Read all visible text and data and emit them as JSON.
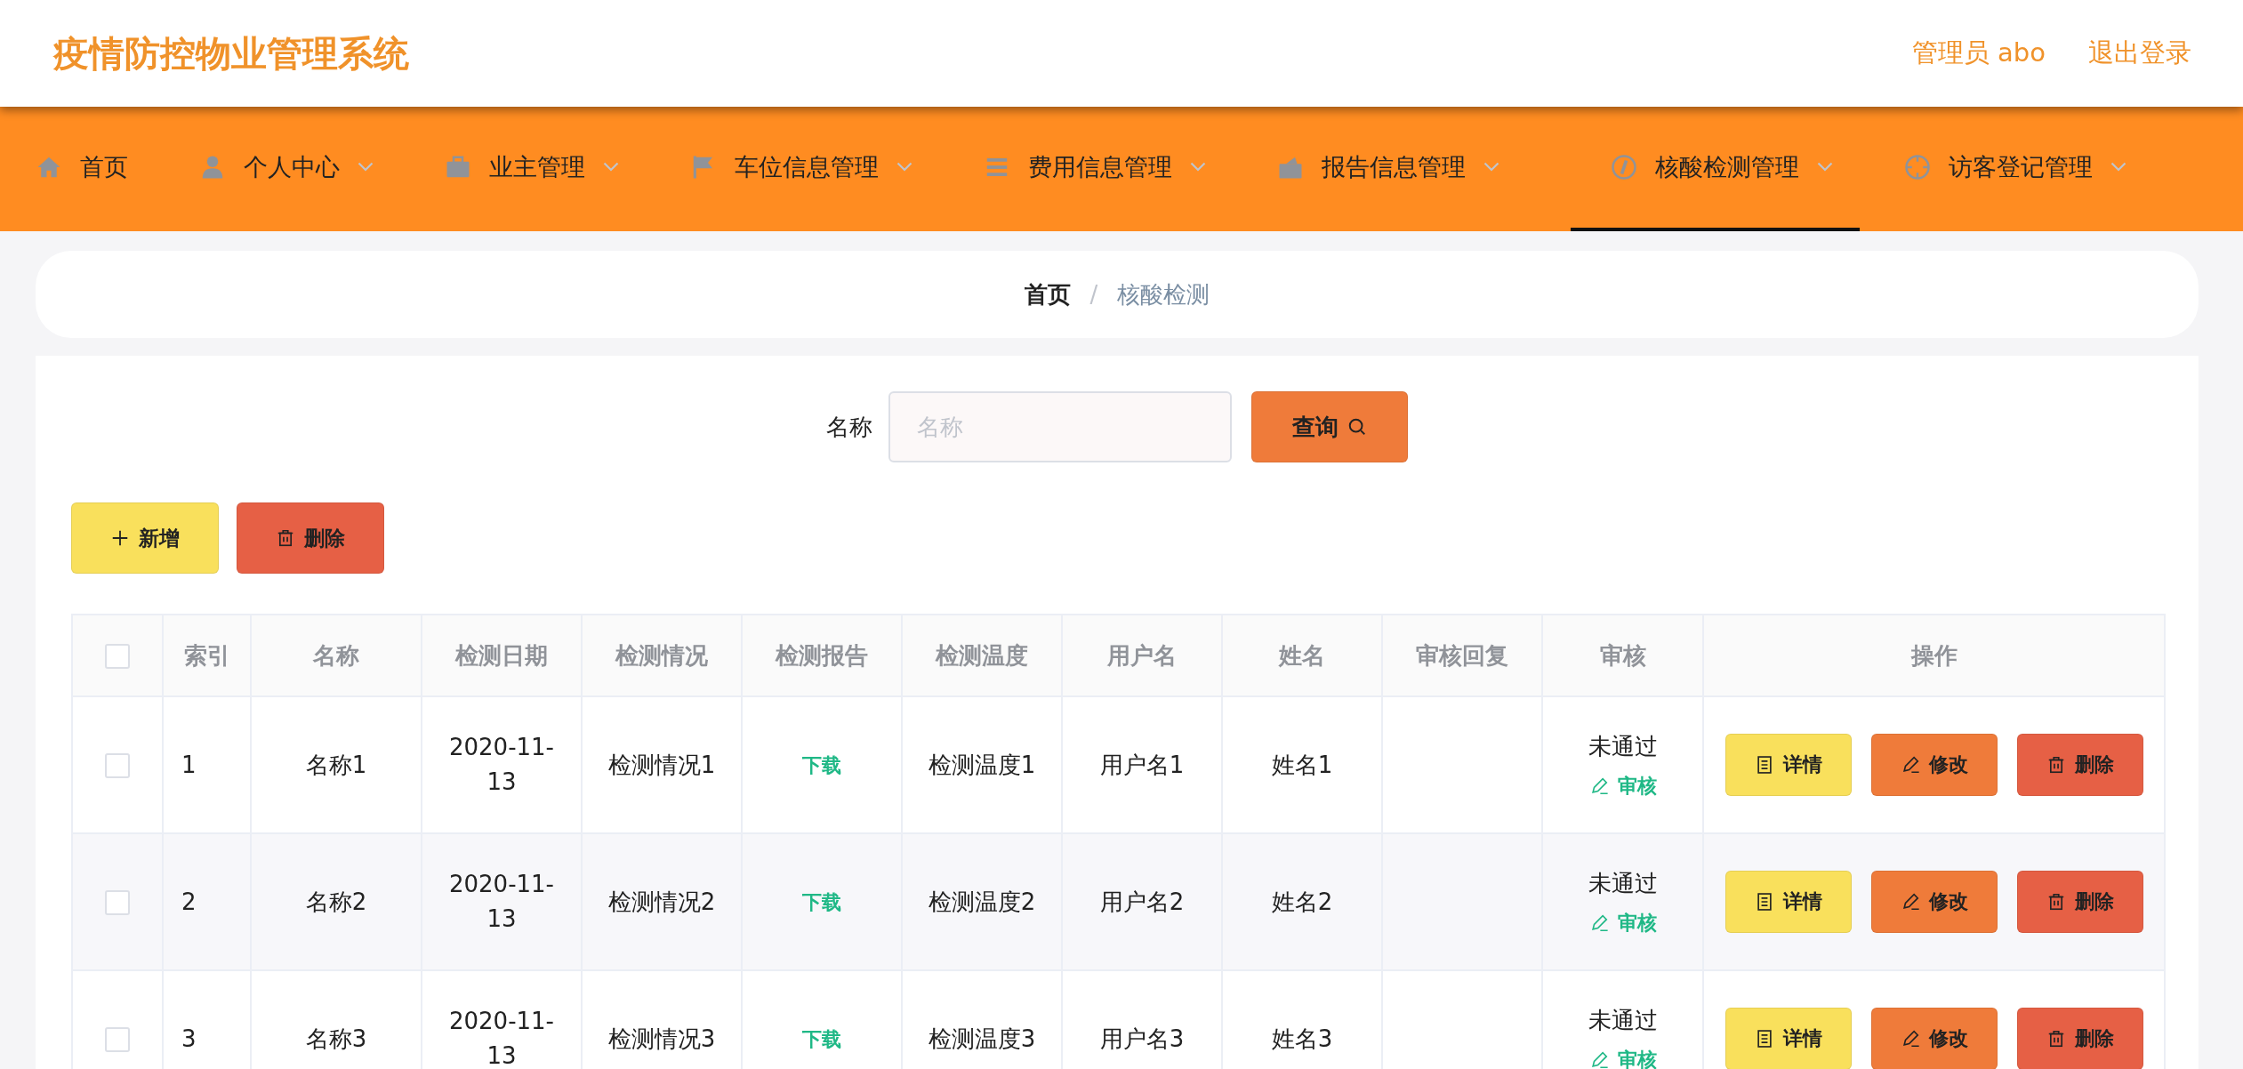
{
  "header": {
    "title": "疫情防控物业管理系统",
    "user": "管理员 abo",
    "logout": "退出登录"
  },
  "nav": [
    {
      "label": "首页",
      "dropdown": false,
      "selected": false
    },
    {
      "label": "个人中心",
      "dropdown": true,
      "selected": false
    },
    {
      "label": "业主管理",
      "dropdown": true,
      "selected": false
    },
    {
      "label": "车位信息管理",
      "dropdown": true,
      "selected": false
    },
    {
      "label": "费用信息管理",
      "dropdown": true,
      "selected": false
    },
    {
      "label": "报告信息管理",
      "dropdown": true,
      "selected": false
    },
    {
      "label": "核酸检测管理",
      "dropdown": true,
      "selected": true
    },
    {
      "label": "访客登记管理",
      "dropdown": true,
      "selected": false
    }
  ],
  "breadcrumb": {
    "items": [
      "首页",
      "核酸检测"
    ],
    "separator": "/"
  },
  "search": {
    "label": "名称",
    "placeholder": "名称",
    "button": "查询"
  },
  "toolbar": [
    {
      "kind": "add",
      "label": "新增"
    },
    {
      "kind": "delete",
      "label": "删除"
    }
  ],
  "table": {
    "select_all_checked": false,
    "columns": [
      "索引",
      "名称",
      "检测日期",
      "检测情况",
      "检测报告",
      "检测温度",
      "用户名",
      "姓名",
      "审核回复",
      "审核",
      "操作"
    ],
    "rows": [
      {
        "checked": false,
        "cells": [
          "1",
          "名称1",
          "2020-11-13",
          "检测情况1"
        ],
        "report": "下载",
        "cells2": [
          "检测温度1",
          "用户名1",
          "姓名1"
        ],
        "audit_status": "未通过",
        "audit_link": "审核",
        "actions": [
          {
            "kind": "detail",
            "label": "详情"
          },
          {
            "kind": "edit",
            "label": "修改"
          },
          {
            "kind": "delete",
            "label": "删除"
          }
        ]
      },
      {
        "checked": false,
        "cells": [
          "2",
          "名称2",
          "2020-11-13",
          "检测情况2"
        ],
        "report": "下载",
        "cells2": [
          "检测温度2",
          "用户名2",
          "姓名2"
        ],
        "audit_status": "未通过",
        "audit_link": "审核",
        "actions": [
          {
            "kind": "detail",
            "label": "详情"
          },
          {
            "kind": "edit",
            "label": "修改"
          },
          {
            "kind": "delete",
            "label": "删除"
          }
        ]
      },
      {
        "checked": false,
        "cells": [
          "3",
          "名称3",
          "2020-11-13",
          "检测情况3"
        ],
        "report": "下载",
        "cells2": [
          "检测温度3",
          "用户名3",
          "姓名3"
        ],
        "audit_status": "未通过",
        "audit_link": "审核",
        "actions": [
          {
            "kind": "detail",
            "label": "详情"
          },
          {
            "kind": "edit",
            "label": "修改"
          },
          {
            "kind": "delete",
            "label": "删除"
          }
        ]
      }
    ]
  }
}
